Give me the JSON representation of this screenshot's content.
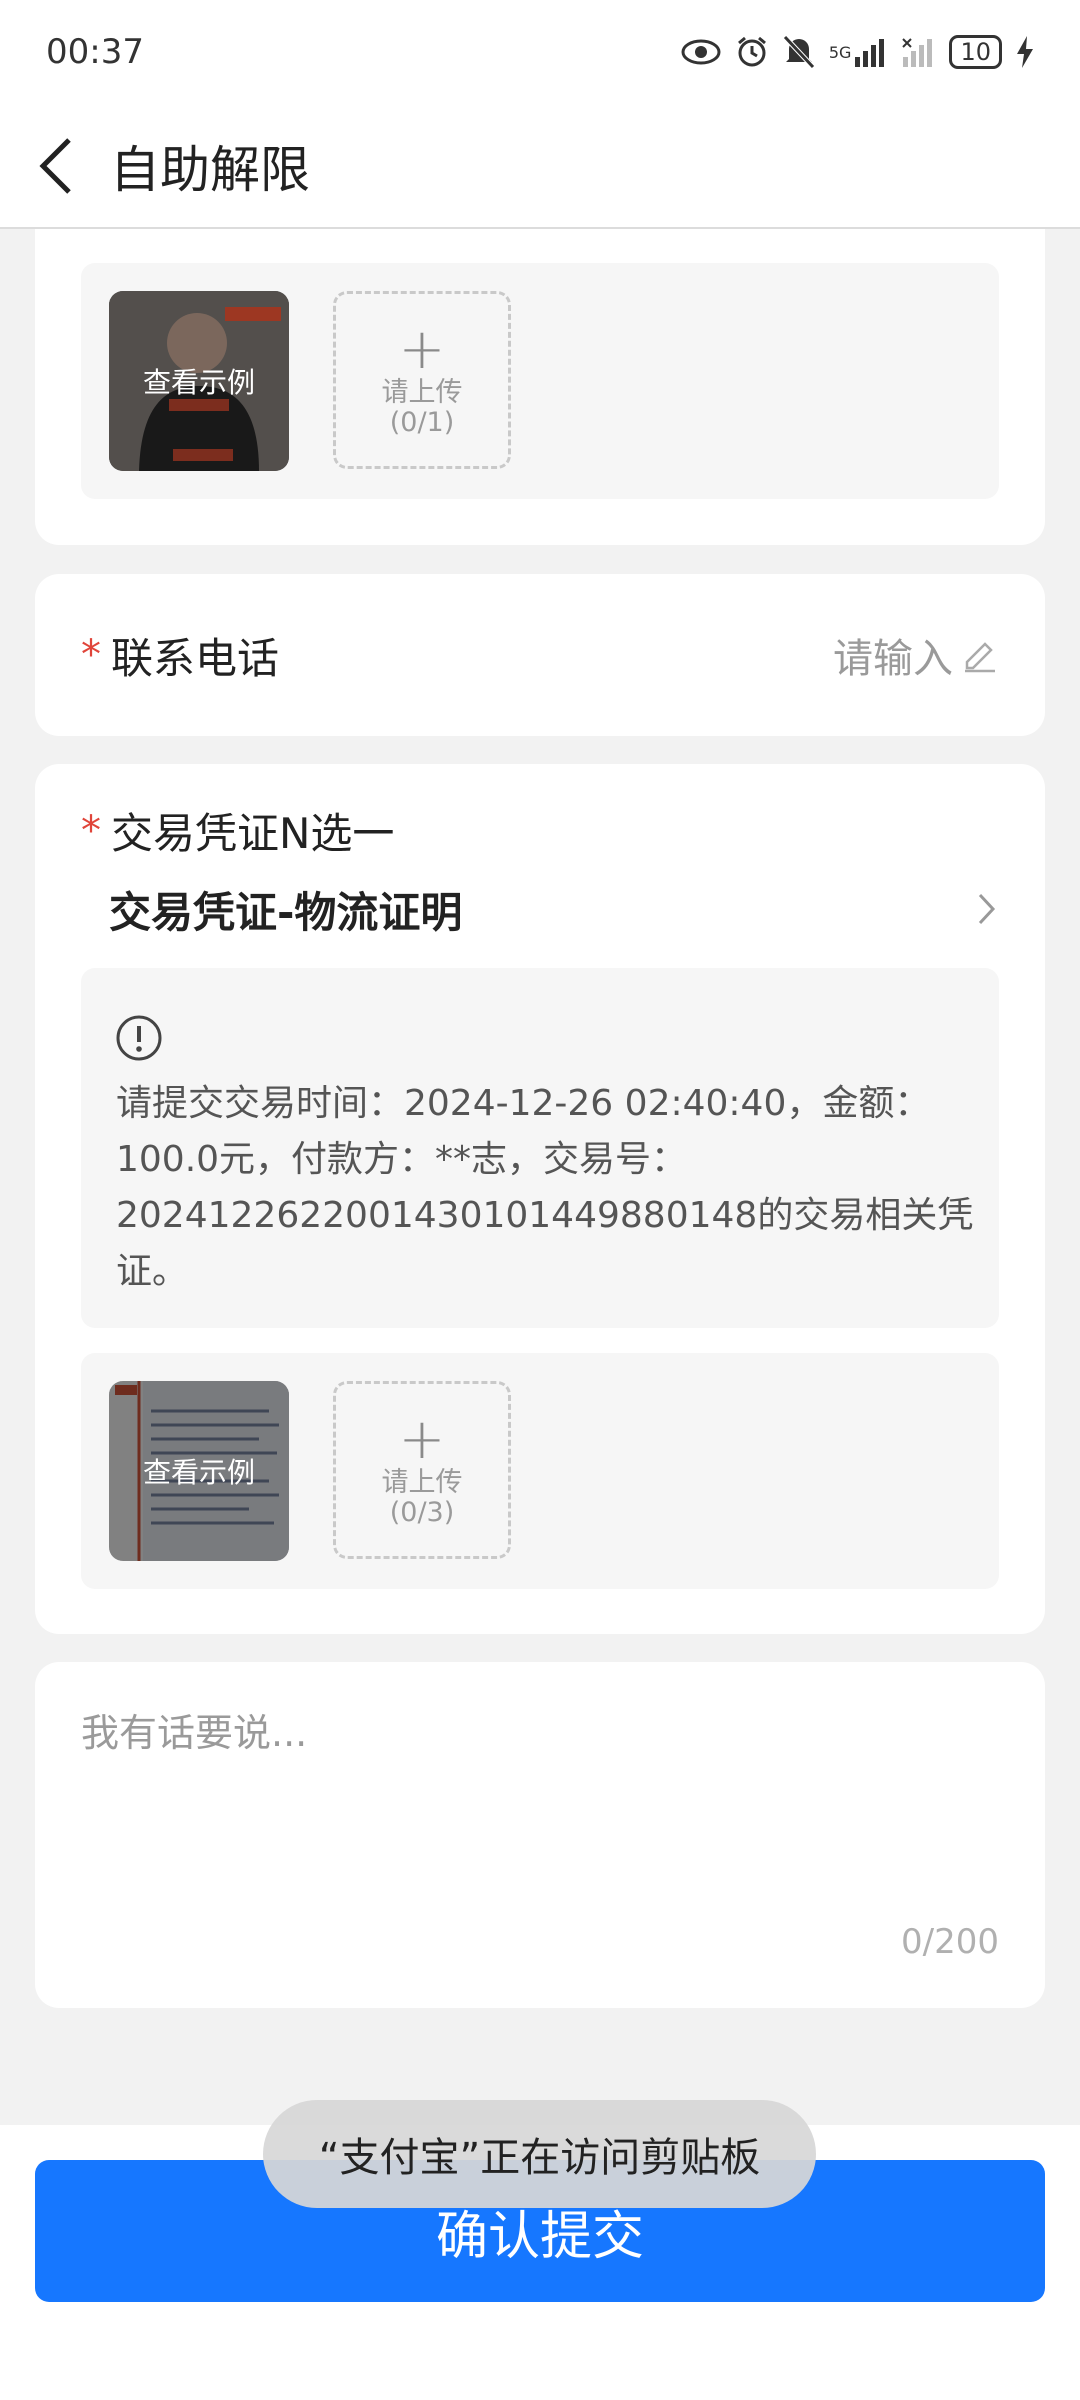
{
  "status_bar": {
    "time": "00:37",
    "network": "5G",
    "battery": "10"
  },
  "header": {
    "title": "自助解限"
  },
  "photo_section": {
    "example_label": "查看示例",
    "upload_label": "请上传",
    "upload_count": "(0/1)"
  },
  "phone_field": {
    "required_mark": "*",
    "label": "联系电话",
    "placeholder": "请输入"
  },
  "voucher_section": {
    "required_mark": "*",
    "label": "交易凭证N选一",
    "selected_option": "交易凭证-物流证明",
    "notice_line1": "请提交交易时间：2024-12-26 02:40:40，金额：",
    "notice_line2": "100.0元，付款方：**志，交易号：",
    "notice_line3": "2024122622001430101449880148的交易相关凭",
    "notice_line4": "证。",
    "example_label": "查看示例",
    "upload_label": "请上传",
    "upload_count": "(0/3)"
  },
  "comment": {
    "placeholder": "我有话要说...",
    "counter": "0/200"
  },
  "submit": {
    "label": "确认提交"
  },
  "toast": {
    "message": "“支付宝”正在访问剪贴板"
  },
  "colors": {
    "primary": "#1677ff",
    "required": "#e0453a",
    "background": "#f2f2f2"
  }
}
